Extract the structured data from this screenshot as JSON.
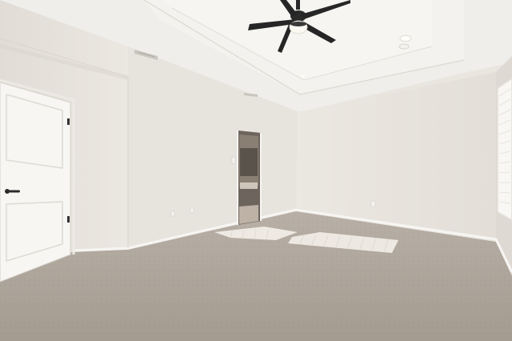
{
  "scene": {
    "description_tag": "empty-bedroom",
    "colors": {
      "wall_left": "#e6e2dc",
      "wall_front": "#ebe7e1",
      "wall_right": "#e8e4de",
      "ceiling": "#f1efec",
      "carpet": "#a9a097",
      "trim": "#f6f5f2",
      "door": "#f7f6f3",
      "fan": "#2a2a2a",
      "sunlight": "#f4f1ea",
      "doorway_dark": "#6b625a"
    },
    "elements": {
      "ceiling_fan": "ceiling-fan-icon",
      "door_handle": "door-handle-icon",
      "recessed_light": "recessed-light-icon",
      "air_vent": "air-vent-icon",
      "window": "window-blinds-icon"
    }
  }
}
